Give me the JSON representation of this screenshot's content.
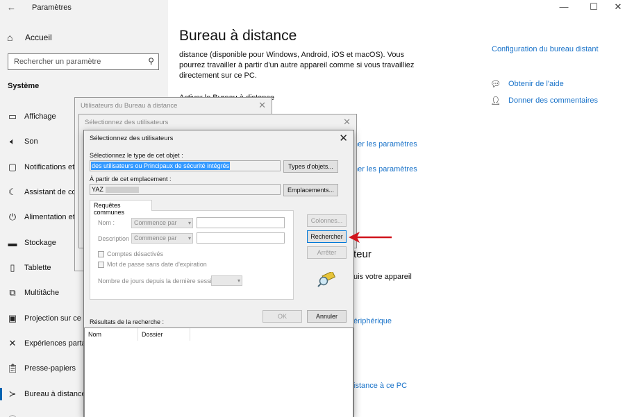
{
  "window": {
    "app_title": "Paramètres",
    "controls": {
      "back": "←",
      "minimize": "—",
      "maximize": "☐",
      "close": "✕"
    }
  },
  "nav": {
    "home_label": "Accueil",
    "search_placeholder": "Rechercher un paramètre",
    "section_title": "Système",
    "items": [
      {
        "label": "Affichage",
        "icon": "monitor-icon"
      },
      {
        "label": "Son",
        "icon": "speaker-icon"
      },
      {
        "label": "Notifications et",
        "icon": "notification-icon"
      },
      {
        "label": "Assistant de co",
        "icon": "moon-icon"
      },
      {
        "label": "Alimentation et",
        "icon": "power-icon"
      },
      {
        "label": "Stockage",
        "icon": "storage-icon"
      },
      {
        "label": "Tablette",
        "icon": "tablet-icon"
      },
      {
        "label": "Multitâche",
        "icon": "multitask-icon"
      },
      {
        "label": "Projection sur ce P",
        "icon": "projection-icon"
      },
      {
        "label": "Expériences partag",
        "icon": "shared-icon"
      },
      {
        "label": "Presse-papiers",
        "icon": "clipboard-icon"
      },
      {
        "label": "Bureau à distance",
        "icon": "remote-desktop-icon"
      }
    ]
  },
  "content": {
    "page_title": "Bureau à distance",
    "description": "distance (disponible pour Windows, Android, iOS et macOS). Vous pourrez travailler à partir d'un autre appareil comme si vous travailliez directement sur ce PC.",
    "activer_label": "Activer le Bureau à distance",
    "link_params_1": "her les paramètres",
    "link_params_2": "her les paramètres",
    "section_heading_fragment": "teur",
    "device_text_fragment": "uis votre appareil",
    "link_peripherique": "ériphérique",
    "link_distance_pc": "istance à ce PC",
    "right_top_link": "Configuration du bureau distant",
    "help_link": "Obtenir de l'aide",
    "feedback_link": "Donner des commentaires"
  },
  "dialog_users": {
    "title": "Utilisateurs du Bureau à distance",
    "close": "✕"
  },
  "dialog_select_back": {
    "title": "Sélectionnez des utilisateurs",
    "close": "✕"
  },
  "dialog_select": {
    "title": "Sélectionnez des utilisateurs",
    "close": "✕",
    "object_type_label": "Sélectionnez le type de cet objet :",
    "object_type_value": "des utilisateurs ou Principaux de sécurité intégrés",
    "object_types_button": "Types d'objets...",
    "location_label": "À partir de cet emplacement :",
    "location_value": "YAZ",
    "locations_button": "Emplacements...",
    "tab_label": "Requêtes communes",
    "name_label": "Nom :",
    "name_combo": "Commence par",
    "description_label": "Description :",
    "description_combo": "Commence par",
    "disabled_accounts_label": "Comptes désactivés",
    "no_expire_label": "Mot de passe sans date d'expiration",
    "days_label": "Nombre de jours depuis la dernière session :",
    "columns_button": "Colonnes...",
    "search_button": "Rechercher",
    "stop_button": "Arrêter",
    "ok_button": "OK",
    "cancel_button": "Annuler",
    "results_label": "Résultats de la recherche :",
    "results_columns": [
      "Nom",
      "Dossier"
    ]
  },
  "colors": {
    "accent": "#0063b1",
    "link": "#1a73c9",
    "selection": "#3399ff",
    "annotation_arrow": "#d0141c"
  }
}
